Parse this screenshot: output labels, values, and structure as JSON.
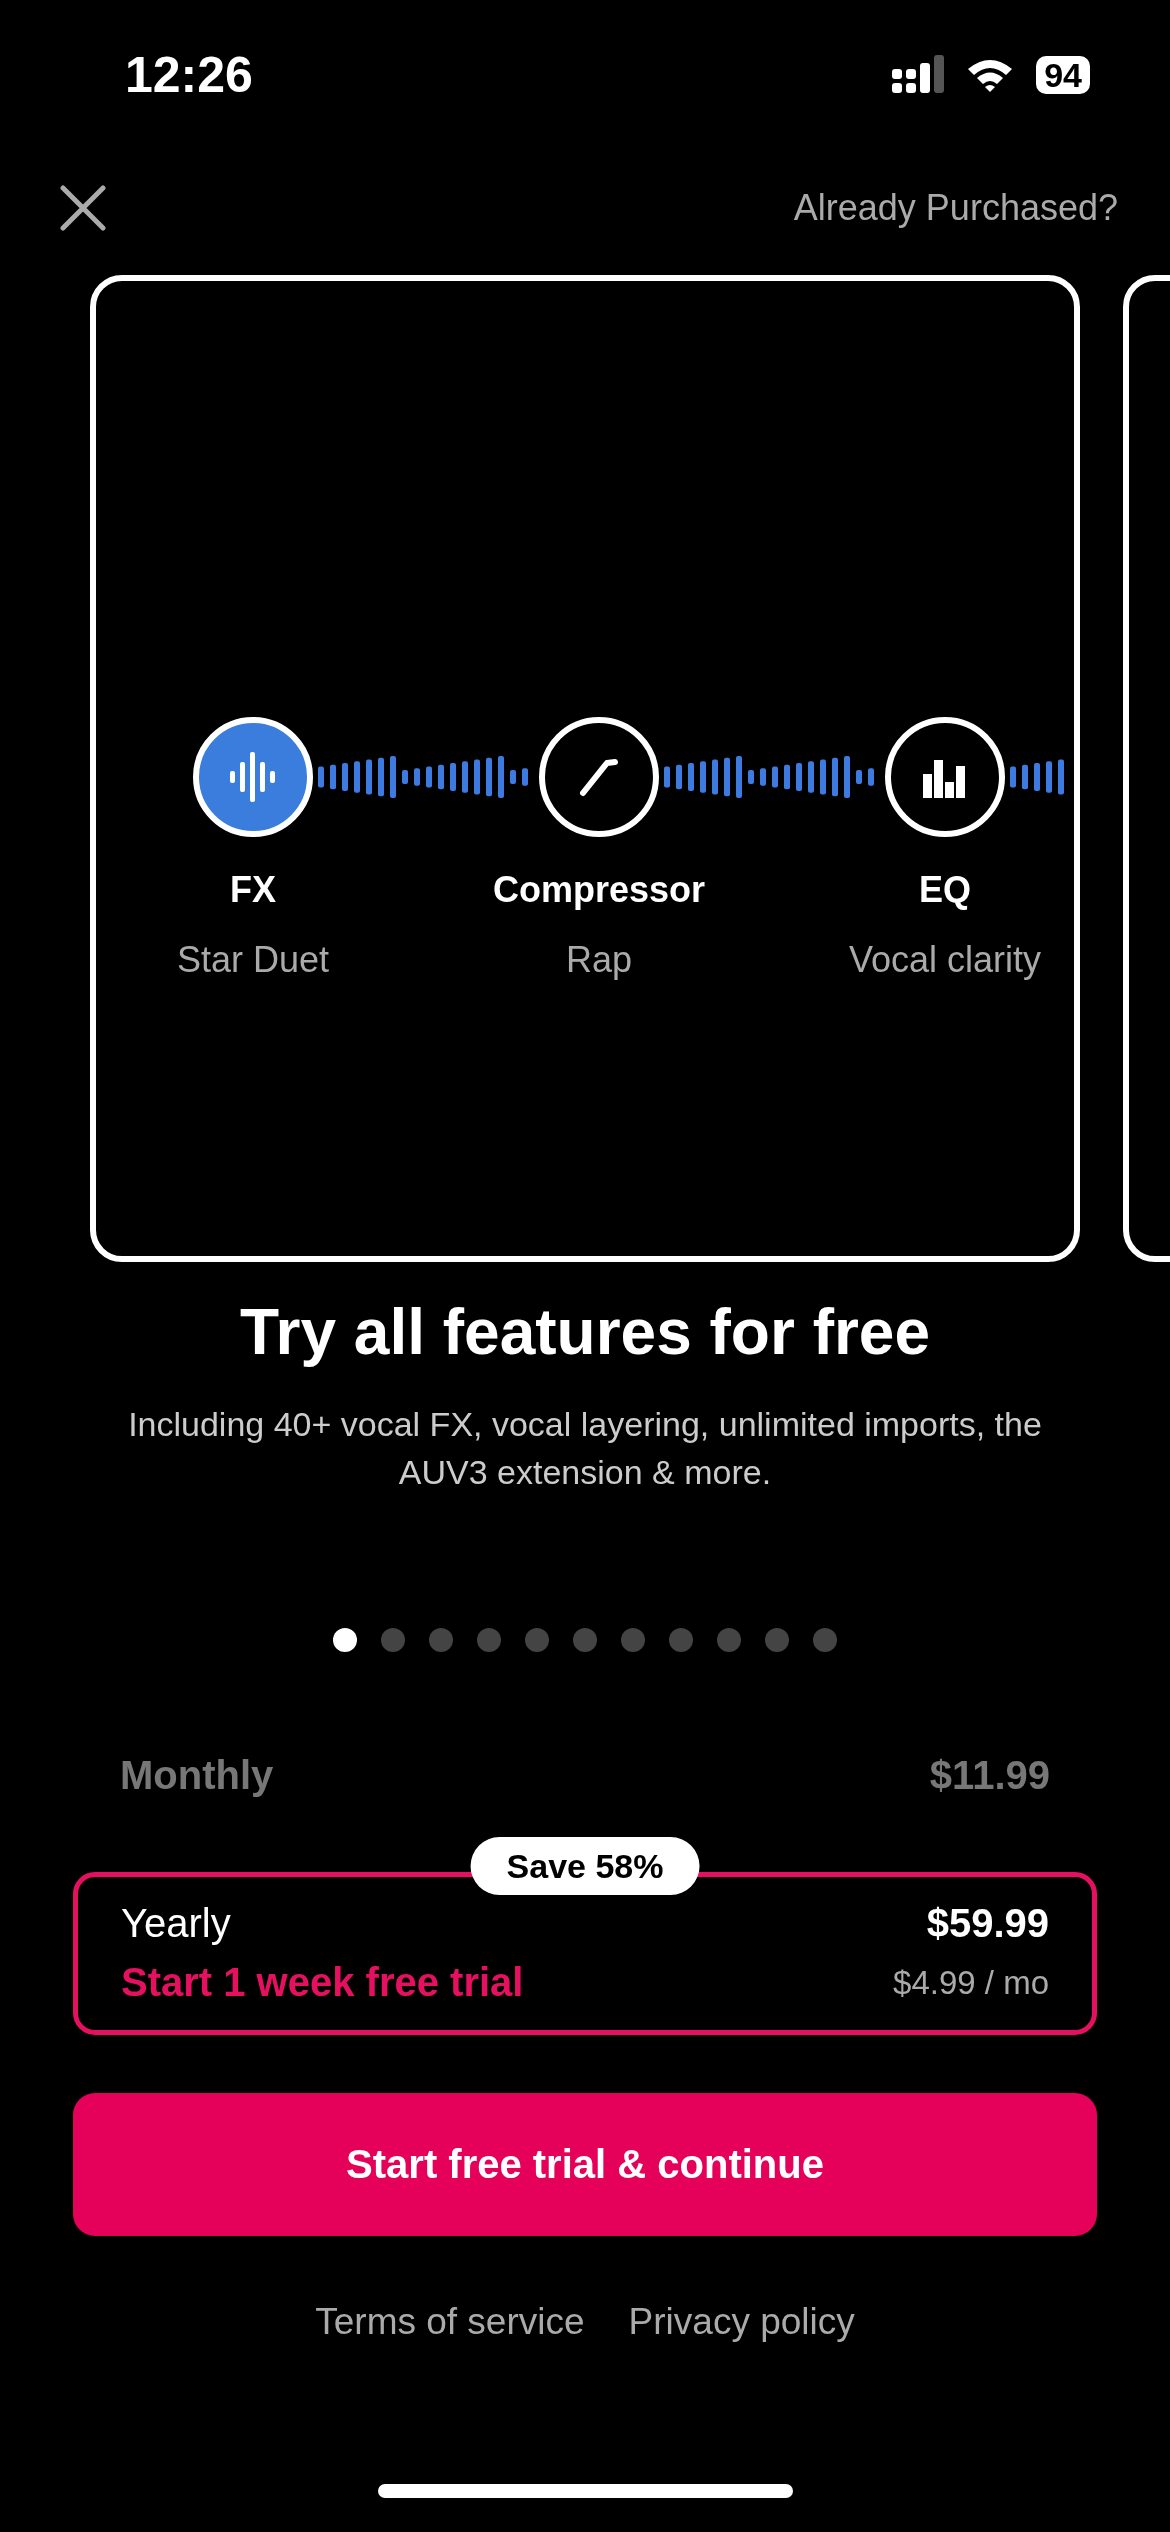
{
  "status_bar": {
    "time": "12:26",
    "battery": "94"
  },
  "nav": {
    "link": "Already Purchased?"
  },
  "features": [
    {
      "kind": "fx",
      "name": "FX",
      "preset": "Star Duet",
      "selected": true
    },
    {
      "kind": "compressor",
      "name": "Compressor",
      "preset": "Rap",
      "selected": false
    },
    {
      "kind": "eq",
      "name": "EQ",
      "preset": "Vocal clarity",
      "selected": false
    }
  ],
  "title": "Try all features for free",
  "subtitle": "Including 40+ vocal FX, vocal layering, unlimited imports, the AUV3 extension & more.",
  "pages": [
    {
      "selected": true
    },
    {
      "selected": false
    },
    {
      "selected": false
    },
    {
      "selected": false
    },
    {
      "selected": false
    },
    {
      "selected": false
    },
    {
      "selected": false
    },
    {
      "selected": false
    },
    {
      "selected": false
    },
    {
      "selected": false
    },
    {
      "selected": false
    }
  ],
  "plans": [
    {
      "name": "Monthly",
      "price": "$11.99",
      "selected": false
    },
    {
      "name": "Yearly",
      "price": "$59.99",
      "badge": "Save 58%",
      "trial": "Start 1 week free trial",
      "per_month": "$4.99 / mo",
      "selected": true
    }
  ],
  "button": "Start free trial & continue",
  "links": [
    "Terms of service",
    "Privacy policy"
  ]
}
